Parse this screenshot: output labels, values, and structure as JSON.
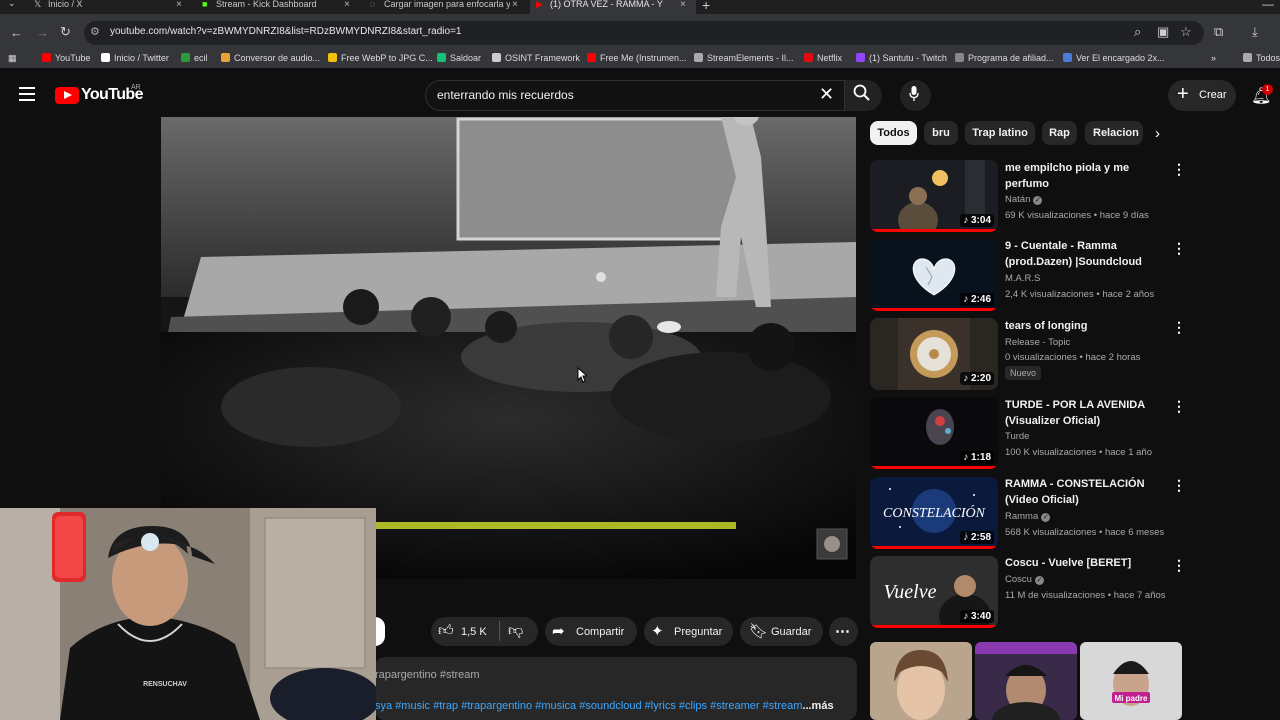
{
  "browser": {
    "tabs": [
      {
        "label": "Inicio / X",
        "icon": "x-logo-icon"
      },
      {
        "label": "Stream - Kick Dashboard",
        "icon": "kick-icon"
      },
      {
        "label": "Cargar imagen para enfocarla y",
        "icon": "loading-icon"
      },
      {
        "label": "(1) OTRA VEZ - RAMMA - Y",
        "icon": "youtube-icon",
        "active": true
      }
    ],
    "url": "youtube.com/watch?v=zBWMYDNRZI8&list=RDzBWMYDNRZI8&start_radio=1",
    "bookmarks": [
      {
        "label": "YouTube",
        "color": "#ff0000"
      },
      {
        "label": "Inicio / Twitter",
        "color": "#ffffff"
      },
      {
        "label": "ecil",
        "color": "#2e9b3a"
      },
      {
        "label": "Conversor de audio...",
        "color": "#e8a23a"
      },
      {
        "label": "Free WebP to JPG C...",
        "color": "#f4c20d"
      },
      {
        "label": "Saldoar",
        "color": "#18c07a"
      },
      {
        "label": "OSINT Framework",
        "color": "#cccccc"
      },
      {
        "label": "Free Me (Instrumen...",
        "color": "#ff0000"
      },
      {
        "label": "StreamElements - Il...",
        "color": "#aaaaaa"
      },
      {
        "label": "Netflix",
        "color": "#e50914"
      },
      {
        "label": "(1) Santutu - Twitch",
        "color": "#9146ff"
      },
      {
        "label": "Programa de afiliad...",
        "color": "#888888"
      },
      {
        "label": "Ver El encargado 2x...",
        "color": "#4a7dd8"
      },
      {
        "label": "Todos",
        "color": "#aaaaaa"
      }
    ]
  },
  "youtube": {
    "logo_text": "YouTube",
    "country": "AR",
    "search_query": "enterrando mis recuerdos",
    "create_label": "Crear",
    "notifications_count": "1"
  },
  "video": {
    "likes": "1,5 K",
    "share_label": "Compartir",
    "ask_label": "Preguntar",
    "save_label": "Guardar",
    "desc_line1": "rapargentino #stream",
    "desc_prefix": "sya ",
    "desc_tags": "#music #trap #trapargentino #musica #soundcloud #lyrics #clips #streamer #stream",
    "desc_more": "...más"
  },
  "chips": [
    "Todos",
    "bru",
    "Trap latino",
    "Rap",
    "Relacion"
  ],
  "recommendations": [
    {
      "title": "me empilcho piola y me perfumo",
      "channel": "Natán",
      "verified": true,
      "views": "69 K visualizaciones",
      "age": "hace 9 días",
      "duration": "3:04"
    },
    {
      "title": "9 - Cuentale - Ramma (prod.Dazen) |Soundcloud",
      "channel": "M.A.R.S",
      "verified": false,
      "views": "2,4 K visualizaciones",
      "age": "hace 2 años",
      "duration": "2:46"
    },
    {
      "title": "tears of longing",
      "channel": "Release - Topic",
      "verified": false,
      "views": "0 visualizaciones",
      "age": "hace 2 horas",
      "duration": "2:20",
      "badge": "Nuevo"
    },
    {
      "title": "TURDE - POR LA AVENIDA (Visualizer Oficial)",
      "channel": "Turde",
      "verified": false,
      "views": "100 K visualizaciones",
      "age": "hace 1 año",
      "duration": "1:18"
    },
    {
      "title": "RAMMA - CONSTELACIÓN (Video Oficial)",
      "channel": "Ramma",
      "verified": true,
      "views": "568 K visualizaciones",
      "age": "hace 6 meses",
      "duration": "2:58"
    },
    {
      "title": "Coscu - Vuelve [BERET]",
      "channel": "Coscu",
      "verified": true,
      "views": "11 M de visualizaciones",
      "age": "hace 7 años",
      "duration": "3:40"
    }
  ],
  "thumb_texts": {
    "constelacion": "CONSTELACIÓN",
    "vuelve": "Vuelve",
    "short3": "Mi padre"
  },
  "webcam": {
    "shirt_text": "RENSUCHAV"
  }
}
